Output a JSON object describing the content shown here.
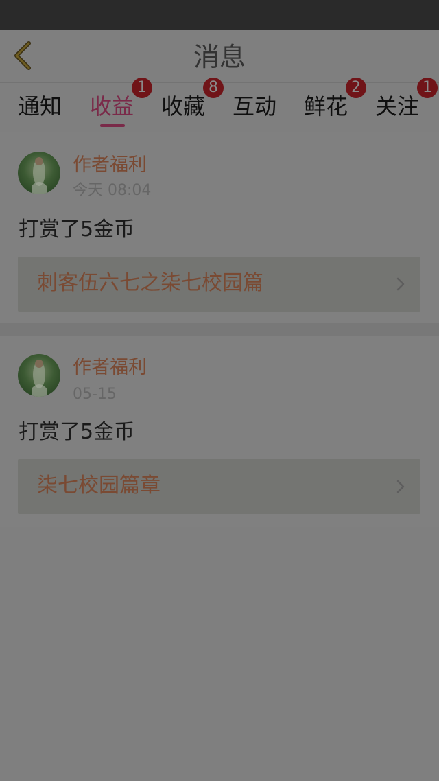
{
  "header": {
    "title": "消息"
  },
  "tabs": [
    {
      "label": "通知",
      "badge": null,
      "active": false
    },
    {
      "label": "收益",
      "badge": "1",
      "active": true
    },
    {
      "label": "收藏",
      "badge": "8",
      "active": false
    },
    {
      "label": "互动",
      "badge": null,
      "active": false
    },
    {
      "label": "鲜花",
      "badge": "2",
      "active": false
    },
    {
      "label": "关注",
      "badge": "1",
      "active": false
    }
  ],
  "messages": [
    {
      "sender": "作者福利",
      "time": "今天 08:04",
      "text": "打赏了5金币",
      "book_title": "刺客伍六七之柒七校园篇"
    },
    {
      "sender": "作者福利",
      "time": "05-15",
      "text": "打赏了5金币",
      "book_title": "柒七校园篇章"
    }
  ],
  "colors": {
    "overlay_background": "#7f7f7f",
    "active_tab": "#7a2a49",
    "badge": "#701418",
    "accent_text": "#7a4a33"
  },
  "icons": {
    "back": "chevron-left-icon",
    "row_arrow": "chevron-right-icon",
    "avatar": "avatar-image"
  }
}
